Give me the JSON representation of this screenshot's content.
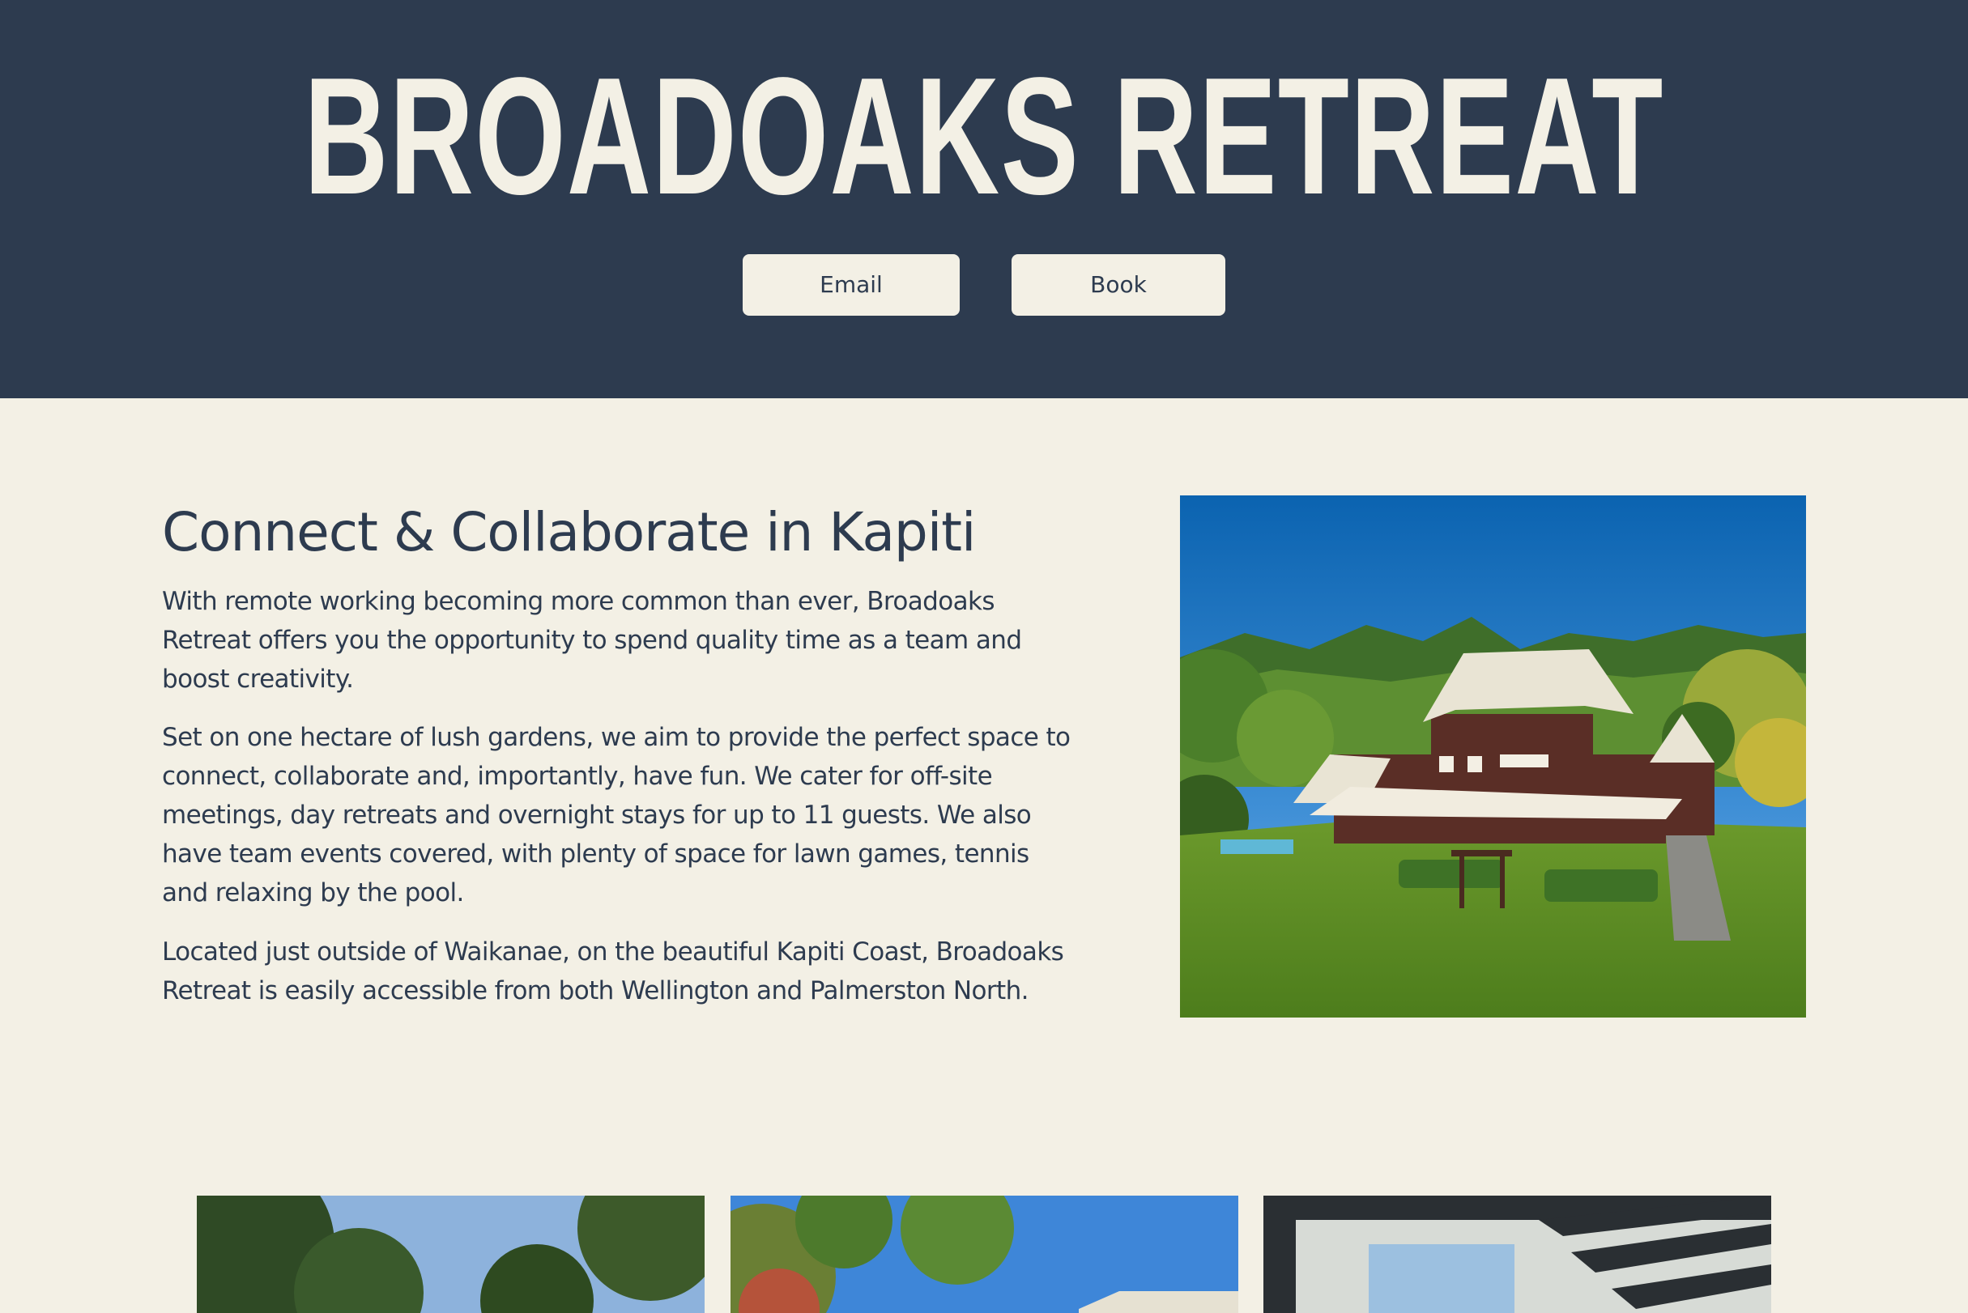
{
  "header": {
    "title": "BROADOAKS RETREAT",
    "buttons": {
      "email_label": "Email",
      "book_label": "Book"
    }
  },
  "intro": {
    "heading": "Connect & Collaborate in Kapiti",
    "paragraphs": [
      "With remote working becoming more common than ever, Broadoaks Retreat offers you the opportunity to spend quality time as a team and boost creativity.",
      "Set on one hectare of lush gardens, we aim to provide the perfect space to connect, collaborate and, importantly, have fun. We cater for off-site meetings, day retreats and overnight stays for up to 11 guests. We also have team events covered, with plenty of space for lawn games, tennis and relaxing by the pool.",
      "Located just outside of Waikanae, on the beautiful Kapiti Coast, Broadoaks Retreat is easily accessible from both Wellington and Palmerston North."
    ]
  },
  "colors": {
    "header_bg": "#2d3b4f",
    "page_bg": "#f3f0e5",
    "text": "#2d3b4f",
    "button_bg": "#f3f0e5"
  }
}
